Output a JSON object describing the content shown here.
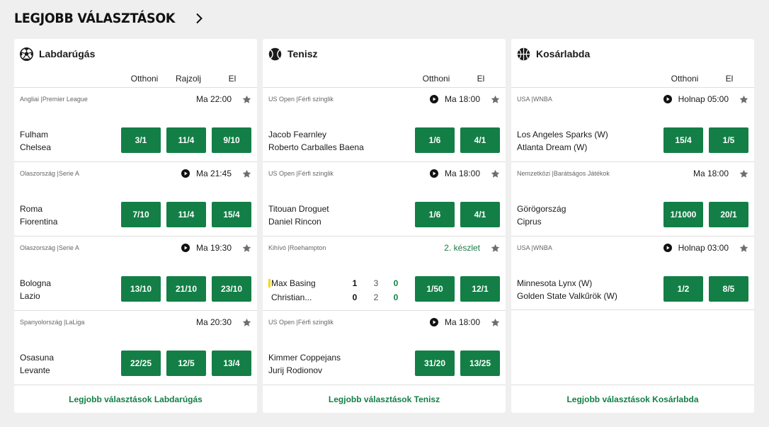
{
  "header": {
    "title": "LEGJOBB VÁLASZTÁSOK"
  },
  "colors": {
    "accent": "#137f46",
    "serve_indicator": "#f5d90a"
  },
  "cards": [
    {
      "sport": "Labdarúgás",
      "icon": "soccer-ball-icon",
      "columns": [
        "Otthoni",
        "Rajzolj",
        "El"
      ],
      "footer": "Legjobb választások Labdarúgás",
      "events": [
        {
          "league": "Angliai |Premier League",
          "time": "Ma 22:00",
          "teams": [
            "Fulham",
            "Chelsea"
          ],
          "odds": [
            "3/1",
            "11/4",
            "9/10"
          ]
        },
        {
          "league": "Olaszország |Serie A",
          "time": "Ma 21:45",
          "teams": [
            "Roma",
            "Fiorentina"
          ],
          "odds": [
            "7/10",
            "11/4",
            "15/4"
          ]
        },
        {
          "league": "Olaszország |Serie A",
          "time": "Ma 19:30",
          "teams": [
            "Bologna",
            "Lazio"
          ],
          "odds": [
            "13/10",
            "21/10",
            "23/10"
          ]
        },
        {
          "league": "Spanyolország |LaLiga",
          "time": "Ma 20:30",
          "teams": [
            "Osasuna",
            "Levante"
          ],
          "odds": [
            "22/25",
            "12/5",
            "13/4"
          ]
        }
      ]
    },
    {
      "sport": "Tenisz",
      "icon": "tennis-ball-icon",
      "columns": [
        "Otthoni",
        "El"
      ],
      "footer": "Legjobb választások Tenisz",
      "events": [
        {
          "league": "US Open |Férfi szinglik",
          "time": "Ma 18:00",
          "teams": [
            "Jacob Fearnley",
            "Roberto Carballes Baena"
          ],
          "odds": [
            "1/6",
            "4/1"
          ]
        },
        {
          "league": "US Open |Férfi szinglik",
          "time": "Ma 18:00",
          "teams": [
            "Titouan Droguet",
            "Daniel Rincon"
          ],
          "odds": [
            "1/6",
            "4/1"
          ]
        },
        {
          "league": "Kihívó |Roehampton",
          "time": "2. készlet",
          "live": true,
          "players": [
            {
              "name": "Max Basing",
              "score": "1",
              "sets": "3",
              "points": "0"
            },
            {
              "name": "Christian...",
              "score": "0",
              "sets": "2",
              "points": "0"
            }
          ],
          "odds": [
            "1/50",
            "12/1"
          ]
        },
        {
          "league": "US Open |Férfi szinglik",
          "time": "Ma 18:00",
          "teams": [
            "Kimmer Coppejans",
            "Jurij Rodionov"
          ],
          "odds": [
            "31/20",
            "13/25"
          ]
        }
      ]
    },
    {
      "sport": "Kosárlabda",
      "icon": "basketball-icon",
      "columns": [
        "Otthoni",
        "El"
      ],
      "footer": "Legjobb választások Kosárlabda",
      "events": [
        {
          "league": "USA |WNBA",
          "time": "Holnap 05:00",
          "teams": [
            "Los Angeles Sparks (W)",
            "Atlanta Dream (W)"
          ],
          "odds": [
            "15/4",
            "1/5"
          ]
        },
        {
          "league": "Nemzetközi |Barátságos Játékok",
          "time": "Ma 18:00",
          "teams": [
            "Görögország",
            "Ciprus"
          ],
          "odds": [
            "1/1000",
            "20/1"
          ]
        },
        {
          "league": "USA |WNBA",
          "time": "Holnap 03:00",
          "teams": [
            "Minnesota Lynx (W)",
            "Golden State Valkűrök (W)"
          ],
          "odds": [
            "1/2",
            "8/5"
          ]
        }
      ]
    }
  ]
}
